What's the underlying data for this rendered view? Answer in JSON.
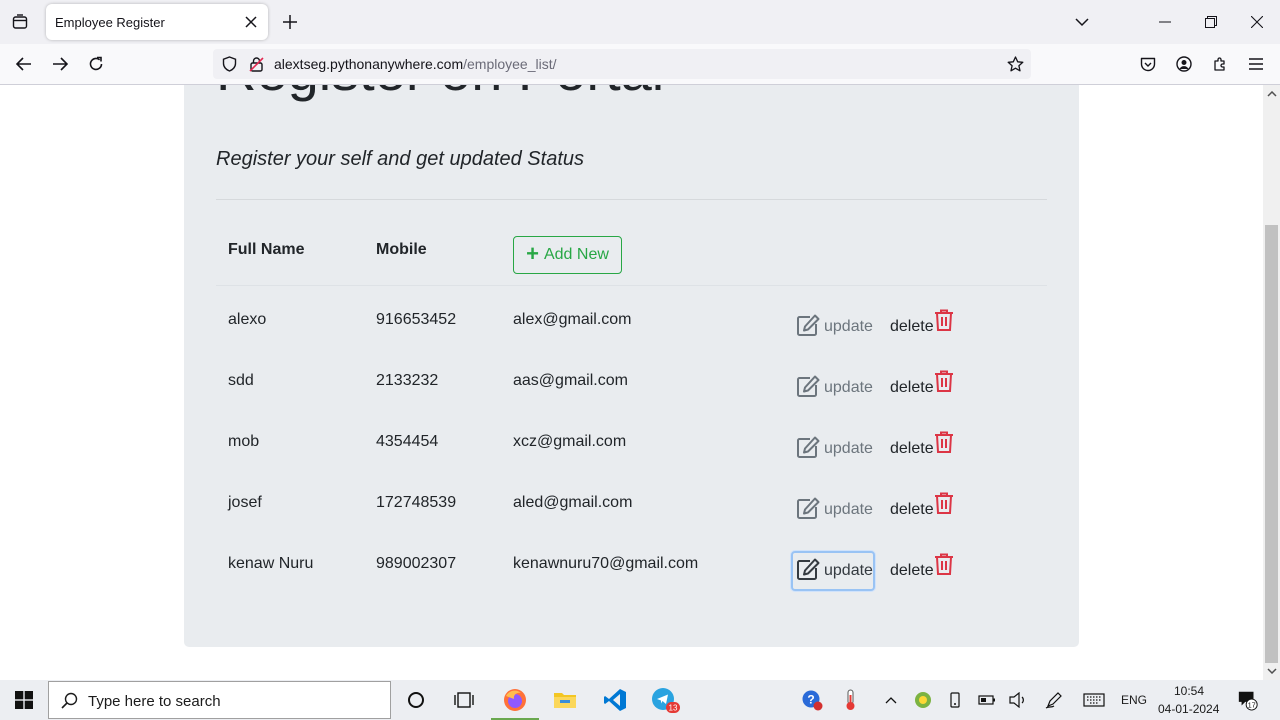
{
  "browser": {
    "tab_title": "Employee Register",
    "url_host": "alextseg.pythonanywhere.com",
    "url_path": "/employee_list/"
  },
  "page": {
    "heading": "Register on Portal",
    "lead": "Register your self and get updated Status",
    "columns": {
      "full_name": "Full Name",
      "mobile": "Mobile"
    },
    "add_new_label": "Add New",
    "update_label": "update",
    "delete_label": "delete",
    "employees": [
      {
        "name": "alexo",
        "mobile": "916653452",
        "email": "alex@gmail.com"
      },
      {
        "name": "sdd",
        "mobile": "2133232",
        "email": "aas@gmail.com"
      },
      {
        "name": "mob",
        "mobile": "4354454",
        "email": "xcz@gmail.com"
      },
      {
        "name": "josef",
        "mobile": "172748539",
        "email": "aled@gmail.com"
      },
      {
        "name": "kenaw Nuru",
        "mobile": "989002307",
        "email": "kenawnuru70@gmail.com"
      }
    ]
  },
  "taskbar": {
    "search_placeholder": "Type here to search",
    "language": "ENG",
    "time": "10:54",
    "date": "04-01-2024",
    "notification_count": "17",
    "telegram_badge": "13"
  },
  "colors": {
    "success": "#28a745",
    "danger": "#dc3545",
    "jumbotron_bg": "#e9ecef",
    "focus_ring": "#99c3f4"
  }
}
